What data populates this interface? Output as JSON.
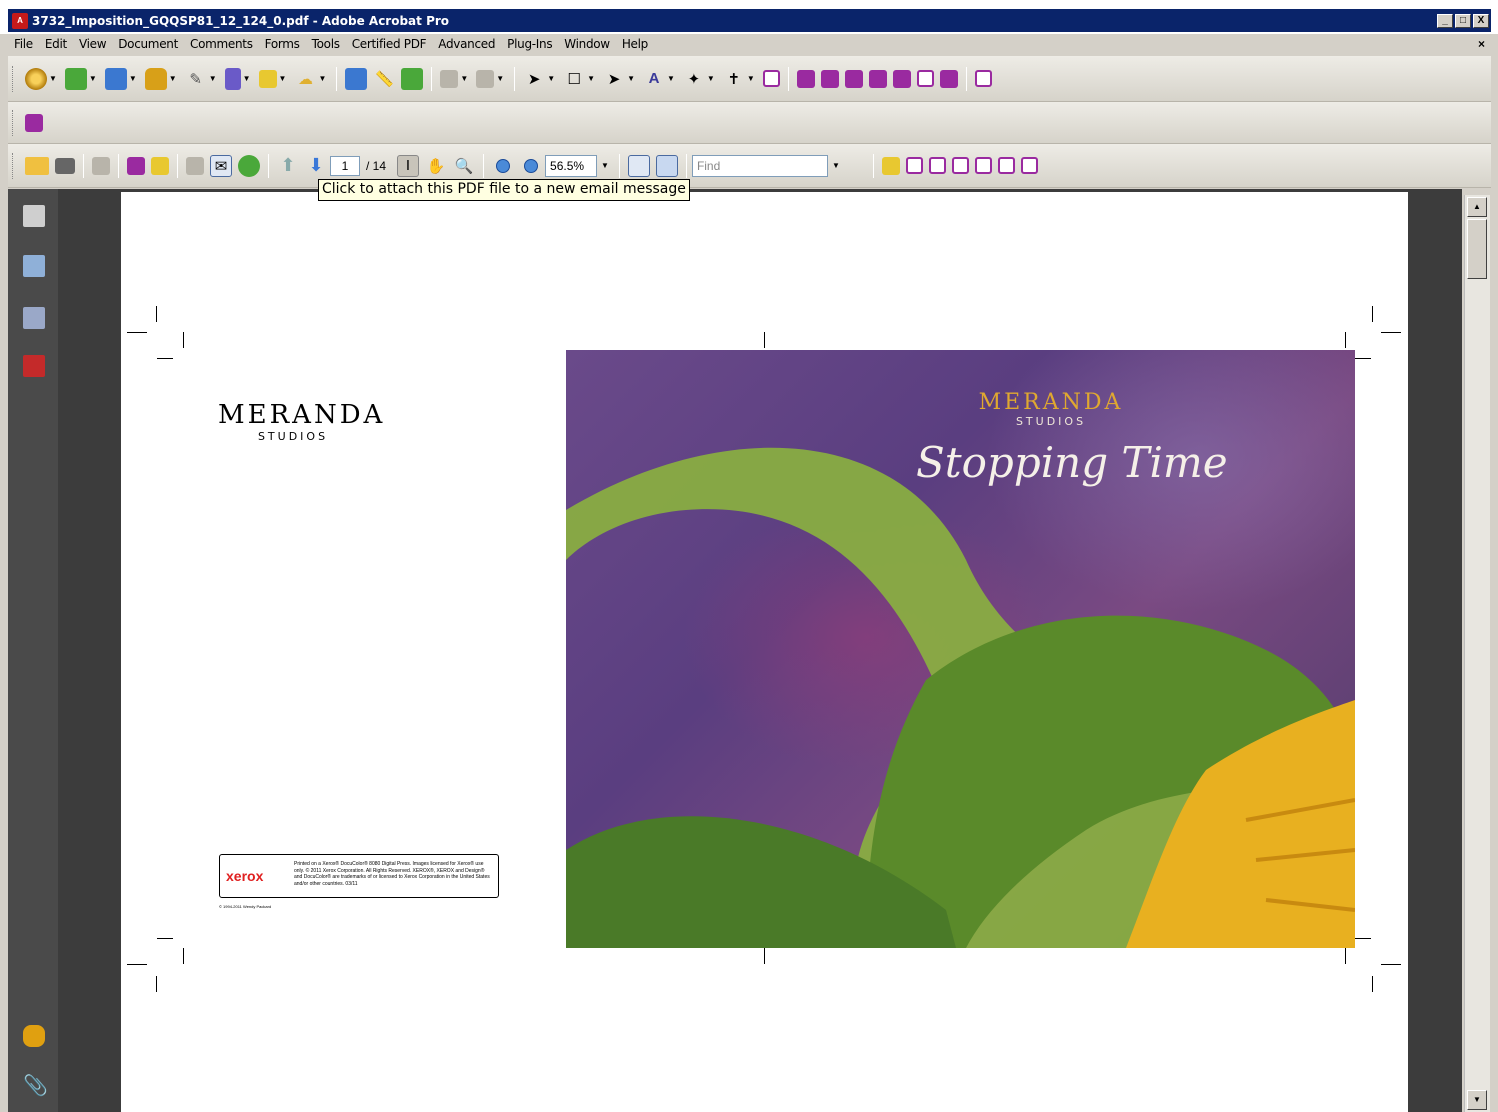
{
  "window": {
    "title": "3732_Imposition_GQQSP81_12_124_0.pdf - Adobe Acrobat Pro",
    "app_icon": "pdf-icon",
    "controls": [
      "_",
      "□",
      "X"
    ]
  },
  "menu": {
    "items": [
      "File",
      "Edit",
      "View",
      "Document",
      "Comments",
      "Forms",
      "Tools",
      "Certified PDF",
      "Advanced",
      "Plug-Ins",
      "Window",
      "Help"
    ],
    "close": "×"
  },
  "toolbar": {
    "page_current": "1",
    "page_total": "/ 14",
    "zoom": "56.5%",
    "find_placeholder": "Find",
    "tooltip": "Click to attach this PDF file to a new email message"
  },
  "page": {
    "left_logo": {
      "name": "MERANDA",
      "sub": "STUDIOS"
    },
    "cover_logo": {
      "name": "MERANDA",
      "sub": "STUDIOS"
    },
    "cover_title": "Stopping Time",
    "xerox_logo": "xerox",
    "xerox_fine_print": "Printed on a Xerox® DocuColor® 8080 Digital Press. Images licensed for Xerox® use only. © 2011 Xerox Corporation. All Rights Reserved. XEROX®, XEROX and Design® and DocuColor® are trademarks of or licensed to Xerox Corporation in the United States and/or other countries. 03/11",
    "copyright": "© 1994-2011 Wendy Packard"
  },
  "colors": {
    "titlebar": "#0a246a",
    "viewer_bg": "#3c3c3c",
    "cover_purple": "#5a3e80",
    "logo_gold": "#e0a830"
  }
}
